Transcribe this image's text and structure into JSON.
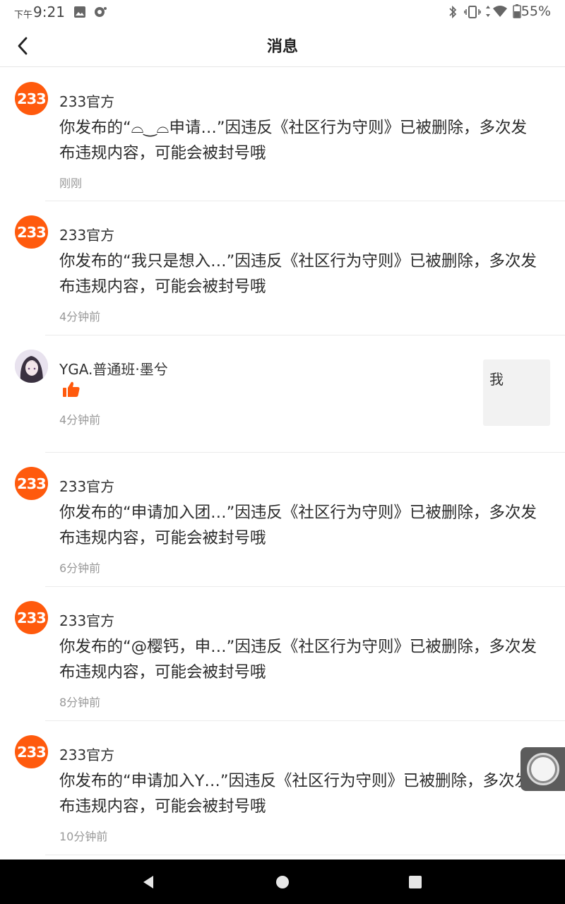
{
  "status_bar": {
    "time_prefix": "下午",
    "time": "9:21",
    "battery": "55%"
  },
  "header": {
    "title": "消息"
  },
  "messages": [
    {
      "avatar_text": "233",
      "sender": "233官方",
      "content": "你发布的“⌓‿⌓申请…”因违反《社区行为守则》已被删除，多次发布违规内容，可能会被封号哦",
      "time": "刚刚"
    },
    {
      "avatar_text": "233",
      "sender": "233官方",
      "content": "你发布的“我只是想入…”因违反《社区行为守则》已被删除，多次发布违规内容，可能会被封号哦",
      "time": "4分钟前"
    },
    {
      "sender": "YGA.普通班·墨兮",
      "time": "4分钟前",
      "preview": "我"
    },
    {
      "avatar_text": "233",
      "sender": "233官方",
      "content": "你发布的“申请加入团…”因违反《社区行为守则》已被删除，多次发布违规内容，可能会被封号哦",
      "time": "6分钟前"
    },
    {
      "avatar_text": "233",
      "sender": "233官方",
      "content": "你发布的“@樱钙，申…”因违反《社区行为守则》已被删除，多次发布违规内容，可能会被封号哦",
      "time": "8分钟前"
    },
    {
      "avatar_text": "233",
      "sender": "233官方",
      "content": "你发布的“申请加入Y…”因违反《社区行为守则》已被删除，多次发布违规内容，可能会被封号哦",
      "time": "10分钟前"
    }
  ],
  "colors": {
    "brand": "#ff5a0d",
    "time_text": "#999999"
  }
}
